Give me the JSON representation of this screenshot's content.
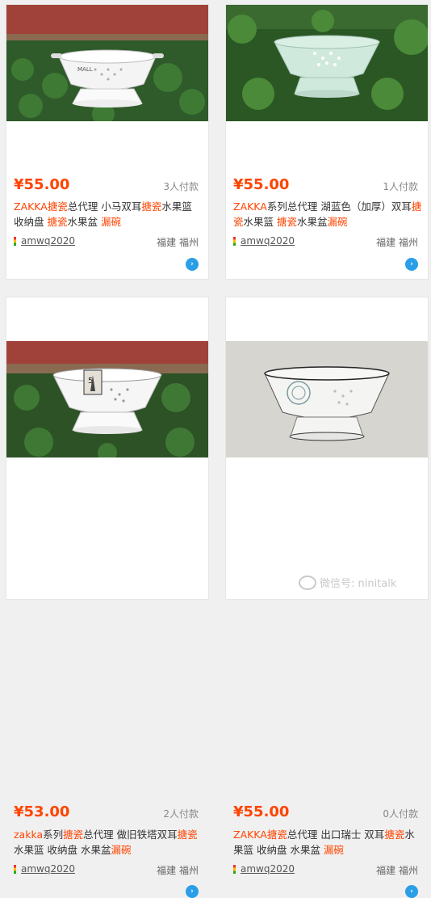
{
  "products": [
    {
      "price": "¥55.00",
      "sold": "3人付款",
      "title": [
        {
          "t": "ZAKKA",
          "h": true
        },
        {
          "t": "搪瓷",
          "h": true
        },
        {
          "t": "总代理 小马双耳"
        },
        {
          "t": "搪瓷",
          "h": true
        },
        {
          "t": "水果篮 收纳盘 "
        },
        {
          "t": "搪瓷",
          "h": true
        },
        {
          "t": "水果盆 "
        },
        {
          "t": "漏碗",
          "h": true
        }
      ],
      "seller": "amwq2020",
      "location": "福建 福州"
    },
    {
      "price": "¥55.00",
      "sold": "1人付款",
      "title": [
        {
          "t": "ZAKKA",
          "h": true
        },
        {
          "t": "系列总代理 湖蓝色（加厚）双耳"
        },
        {
          "t": "搪瓷",
          "h": true
        },
        {
          "t": "水果篮 "
        },
        {
          "t": "搪瓷",
          "h": true
        },
        {
          "t": "水果盆"
        },
        {
          "t": "漏碗",
          "h": true
        }
      ],
      "seller": "amwq2020",
      "location": "福建 福州"
    },
    {
      "price": "¥53.00",
      "sold": "2人付款",
      "title": [
        {
          "t": "zakka",
          "h": true
        },
        {
          "t": "系列"
        },
        {
          "t": "搪瓷",
          "h": true
        },
        {
          "t": "总代理 做旧铁塔双耳"
        },
        {
          "t": "搪瓷",
          "h": true
        },
        {
          "t": "水果篮 收纳盘 水果盆"
        },
        {
          "t": "漏碗",
          "h": true
        }
      ],
      "seller": "amwq2020",
      "location": "福建 福州"
    },
    {
      "price": "¥55.00",
      "sold": "0人付款",
      "title": [
        {
          "t": "ZAKKA",
          "h": true
        },
        {
          "t": "搪瓷",
          "h": true
        },
        {
          "t": "总代理 出口瑞士 双耳"
        },
        {
          "t": "搪瓷",
          "h": true
        },
        {
          "t": "水果篮 收纳盘 水果盆 "
        },
        {
          "t": "漏碗",
          "h": true
        }
      ],
      "seller": "amwq2020",
      "location": "福建 福州"
    }
  ],
  "watermark": "微信号: ninitalk",
  "icons": {
    "chat": "chat-bubble-icon",
    "seller_badge": "seller-badge-icon"
  },
  "colors": {
    "price": "#ff4400",
    "highlight": "#ff4400",
    "chat": "#2b9ee8"
  }
}
